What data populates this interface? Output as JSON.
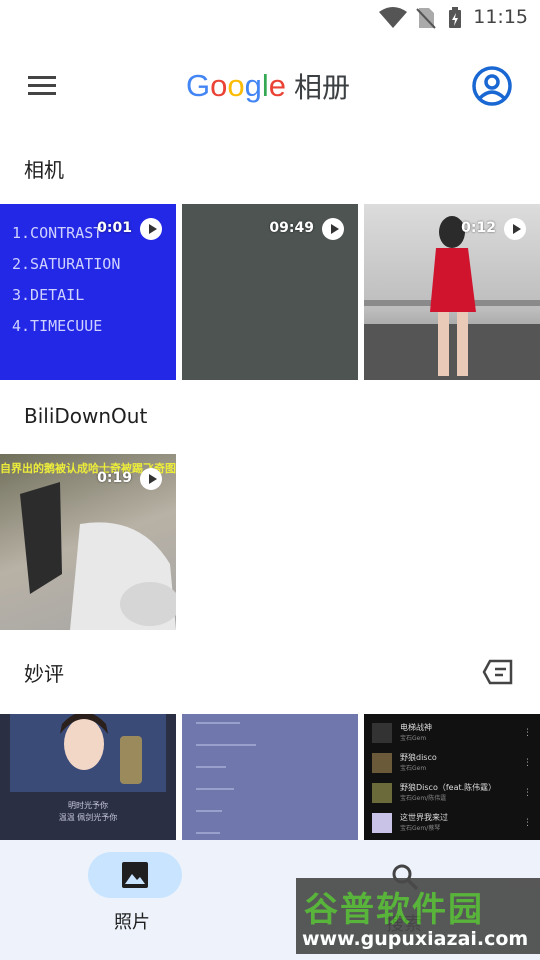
{
  "status_bar": {
    "time": "11:15"
  },
  "app_bar": {
    "brand": [
      "G",
      "o",
      "o",
      "g",
      "l",
      "e"
    ],
    "title_suffix": "相册"
  },
  "sections": [
    {
      "title": "相机",
      "items": [
        {
          "kind": "video",
          "duration": "0:01",
          "text_lines": [
            "1.CONTRAST",
            "2.SATURATION",
            "3.DETAIL",
            "4.TIMECUUE"
          ]
        },
        {
          "kind": "video",
          "duration": "09:49"
        },
        {
          "kind": "video",
          "duration": "0:12"
        }
      ]
    },
    {
      "title": "BiliDownOut",
      "items": [
        {
          "kind": "video",
          "duration": "0:19",
          "caption": "自界出的鹅被认成哈士奇被踢飞奇图"
        }
      ]
    },
    {
      "title": "妙评",
      "items": [
        {
          "kind": "image",
          "caption_lines": [
            "明时光予你",
            "温温 佩剑光予你"
          ]
        },
        {
          "kind": "image"
        },
        {
          "kind": "image",
          "tracks": [
            {
              "name": "电梯战神",
              "artist": "宝石Gem"
            },
            {
              "name": "野狼disco",
              "artist": "宝石Gem"
            },
            {
              "name": "野狼Disco（feat.陈伟霆）",
              "artist": "宝石Gem/陈伟霆"
            },
            {
              "name": "这世界我来过",
              "artist": "宝石Gem/蔡琴"
            }
          ]
        }
      ]
    }
  ],
  "bottom_nav": {
    "photos_label": "照片",
    "search_label": "搜索"
  },
  "watermark": {
    "line1": "谷普软件园",
    "line2": "www.gupuxiazai.com"
  },
  "colors": {
    "accent": "#1967d2",
    "nav_bg": "#eef3fb",
    "nav_pill": "#c8e4ff"
  }
}
